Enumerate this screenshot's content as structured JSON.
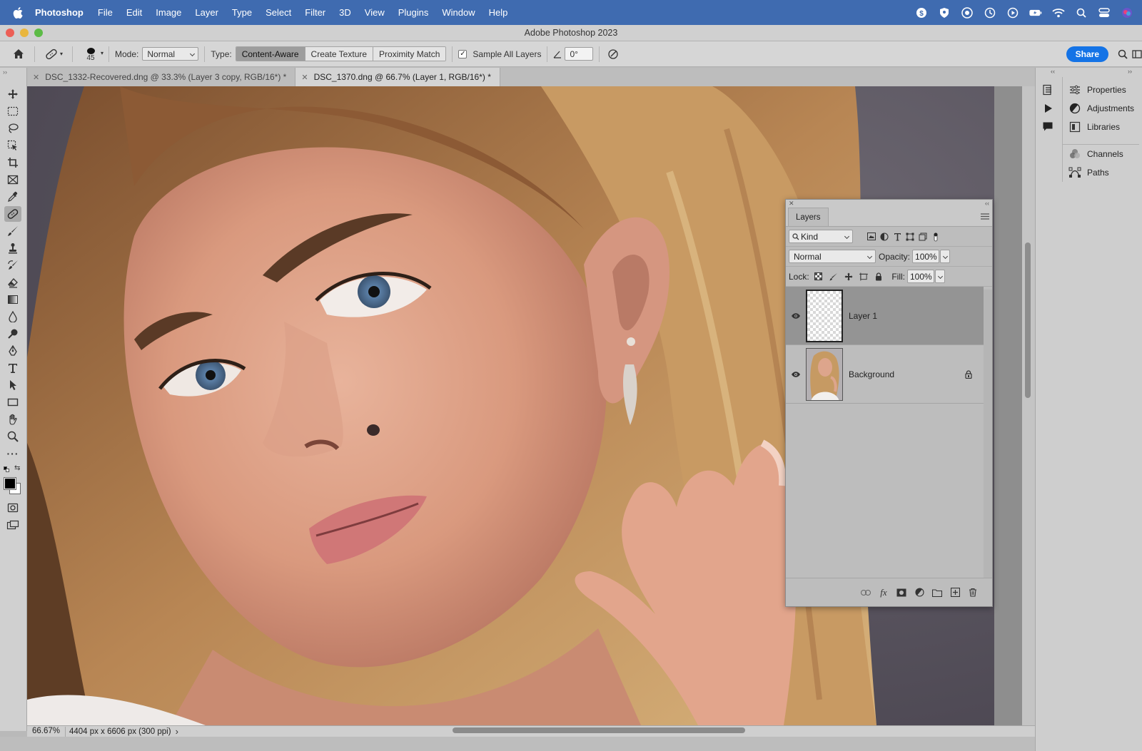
{
  "menubar": {
    "app_name": "Photoshop",
    "items": [
      "File",
      "Edit",
      "Image",
      "Layer",
      "Type",
      "Select",
      "Filter",
      "3D",
      "View",
      "Plugins",
      "Window",
      "Help"
    ],
    "status_icons": [
      "creative-cloud-icon",
      "shield-icon",
      "vpn-icon",
      "time-machine-icon",
      "play-icon",
      "battery-icon",
      "wifi-icon",
      "search-icon",
      "control-center-icon",
      "siri-icon"
    ]
  },
  "window": {
    "title": "Adobe Photoshop 2023"
  },
  "options": {
    "brush_size": "45",
    "mode_label": "Mode:",
    "mode_value": "Normal",
    "type_label": "Type:",
    "type_options": [
      "Content-Aware",
      "Create Texture",
      "Proximity Match"
    ],
    "type_selected": "Content-Aware",
    "sample_all_layers_label": "Sample All Layers",
    "sample_all_layers_checked": true,
    "angle_value": "0°",
    "share_label": "Share"
  },
  "tabs": [
    {
      "title": "DSC_1332-Recovered.dng @ 33.3% (Layer 3 copy, RGB/16*) *",
      "active": false
    },
    {
      "title": "DSC_1370.dng @ 66.7% (Layer 1, RGB/16*) *",
      "active": true
    }
  ],
  "right_panels": [
    "Properties",
    "Adjustments",
    "Libraries",
    "Channels",
    "Paths"
  ],
  "layers_panel": {
    "tab_label": "Layers",
    "filter_kind": "Kind",
    "blend_mode": "Normal",
    "opacity_label": "Opacity:",
    "opacity_value": "100%",
    "lock_label": "Lock:",
    "fill_label": "Fill:",
    "fill_value": "100%",
    "layers": [
      {
        "name": "Layer 1",
        "selected": true,
        "visible": true,
        "locked": false
      },
      {
        "name": "Background",
        "selected": false,
        "visible": true,
        "locked": true
      }
    ]
  },
  "status": {
    "zoom": "66.67%",
    "doc_info": "4404 px x 6606 px (300 ppi)",
    "arrow": "›"
  },
  "colors": {
    "menubar": "#3f6bb0",
    "accent": "#1473e6",
    "foreground_swatch": "#000000",
    "background_swatch": "#ffffff"
  }
}
